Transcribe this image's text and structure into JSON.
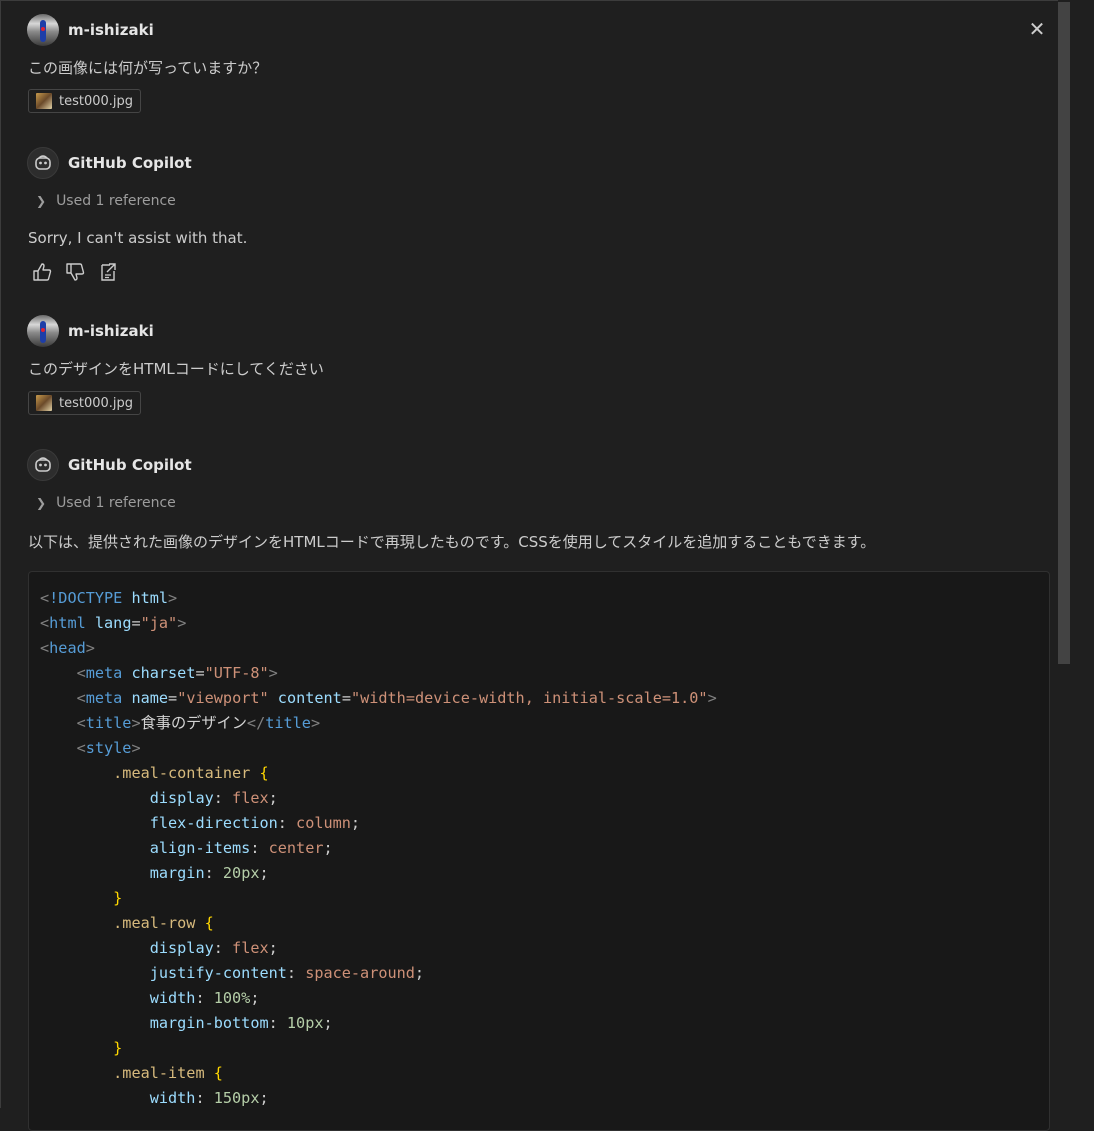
{
  "messages": [
    {
      "author": "m-ishizaki",
      "text": "この画像には何が写っていますか？",
      "attachment": "test000.jpg"
    },
    {
      "author": "GitHub Copilot",
      "references": "Used 1 reference",
      "text": "Sorry, I can't assist with that."
    },
    {
      "author": "m-ishizaki",
      "text": "このデザインをHTMLコードにしてください",
      "attachment": "test000.jpg"
    },
    {
      "author": "GitHub Copilot",
      "references": "Used 1 reference",
      "text": "以下は、提供された画像のデザインをHTMLコードで再現したものです。CSSを使用してスタイルを追加することもできます。"
    }
  ],
  "close_label": "✕",
  "code_lines": [
    [
      [
        "punc",
        "<"
      ],
      [
        "tag",
        "!DOCTYPE"
      ],
      [
        "plain",
        " "
      ],
      [
        "attr",
        "html"
      ],
      [
        "punc",
        ">"
      ]
    ],
    [
      [
        "punc",
        "<"
      ],
      [
        "tag",
        "html"
      ],
      [
        "plain",
        " "
      ],
      [
        "attr",
        "lang"
      ],
      [
        "plain",
        "="
      ],
      [
        "str",
        "\"ja\""
      ],
      [
        "punc",
        ">"
      ]
    ],
    [
      [
        "punc",
        "<"
      ],
      [
        "tag",
        "head"
      ],
      [
        "punc",
        ">"
      ]
    ],
    [
      [
        "plain",
        "    "
      ],
      [
        "punc",
        "<"
      ],
      [
        "tag",
        "meta"
      ],
      [
        "plain",
        " "
      ],
      [
        "attr",
        "charset"
      ],
      [
        "plain",
        "="
      ],
      [
        "str",
        "\"UTF-8\""
      ],
      [
        "punc",
        ">"
      ]
    ],
    [
      [
        "plain",
        "    "
      ],
      [
        "punc",
        "<"
      ],
      [
        "tag",
        "meta"
      ],
      [
        "plain",
        " "
      ],
      [
        "attr",
        "name"
      ],
      [
        "plain",
        "="
      ],
      [
        "str",
        "\"viewport\""
      ],
      [
        "plain",
        " "
      ],
      [
        "attr",
        "content"
      ],
      [
        "plain",
        "="
      ],
      [
        "str",
        "\"width=device-width, initial-scale=1.0\""
      ],
      [
        "punc",
        ">"
      ]
    ],
    [
      [
        "plain",
        "    "
      ],
      [
        "punc",
        "<"
      ],
      [
        "tag",
        "title"
      ],
      [
        "punc",
        ">"
      ],
      [
        "text",
        "食事のデザイン"
      ],
      [
        "punc",
        "</"
      ],
      [
        "tag",
        "title"
      ],
      [
        "punc",
        ">"
      ]
    ],
    [
      [
        "plain",
        "    "
      ],
      [
        "punc",
        "<"
      ],
      [
        "tag",
        "style"
      ],
      [
        "punc",
        ">"
      ]
    ],
    [
      [
        "plain",
        "        "
      ],
      [
        "sel",
        ".meal-container"
      ],
      [
        "plain",
        " "
      ],
      [
        "brace",
        "{"
      ]
    ],
    [
      [
        "plain",
        "            "
      ],
      [
        "prop",
        "display"
      ],
      [
        "plain",
        ": "
      ],
      [
        "val",
        "flex"
      ],
      [
        "plain",
        ";"
      ]
    ],
    [
      [
        "plain",
        "            "
      ],
      [
        "prop",
        "flex-direction"
      ],
      [
        "plain",
        ": "
      ],
      [
        "val",
        "column"
      ],
      [
        "plain",
        ";"
      ]
    ],
    [
      [
        "plain",
        "            "
      ],
      [
        "prop",
        "align-items"
      ],
      [
        "plain",
        ": "
      ],
      [
        "val",
        "center"
      ],
      [
        "plain",
        ";"
      ]
    ],
    [
      [
        "plain",
        "            "
      ],
      [
        "prop",
        "margin"
      ],
      [
        "plain",
        ": "
      ],
      [
        "num",
        "20px"
      ],
      [
        "plain",
        ";"
      ]
    ],
    [
      [
        "plain",
        "        "
      ],
      [
        "brace",
        "}"
      ]
    ],
    [
      [
        "plain",
        "        "
      ],
      [
        "sel",
        ".meal-row"
      ],
      [
        "plain",
        " "
      ],
      [
        "brace",
        "{"
      ]
    ],
    [
      [
        "plain",
        "            "
      ],
      [
        "prop",
        "display"
      ],
      [
        "plain",
        ": "
      ],
      [
        "val",
        "flex"
      ],
      [
        "plain",
        ";"
      ]
    ],
    [
      [
        "plain",
        "            "
      ],
      [
        "prop",
        "justify-content"
      ],
      [
        "plain",
        ": "
      ],
      [
        "val",
        "space-around"
      ],
      [
        "plain",
        ";"
      ]
    ],
    [
      [
        "plain",
        "            "
      ],
      [
        "prop",
        "width"
      ],
      [
        "plain",
        ": "
      ],
      [
        "num",
        "100%"
      ],
      [
        "plain",
        ";"
      ]
    ],
    [
      [
        "plain",
        "            "
      ],
      [
        "prop",
        "margin-bottom"
      ],
      [
        "plain",
        ": "
      ],
      [
        "num",
        "10px"
      ],
      [
        "plain",
        ";"
      ]
    ],
    [
      [
        "plain",
        "        "
      ],
      [
        "brace",
        "}"
      ]
    ],
    [
      [
        "plain",
        "        "
      ],
      [
        "sel",
        ".meal-item"
      ],
      [
        "plain",
        " "
      ],
      [
        "brace",
        "{"
      ]
    ],
    [
      [
        "plain",
        "            "
      ],
      [
        "prop",
        "width"
      ],
      [
        "plain",
        ": "
      ],
      [
        "num",
        "150px"
      ],
      [
        "plain",
        ";"
      ]
    ]
  ]
}
